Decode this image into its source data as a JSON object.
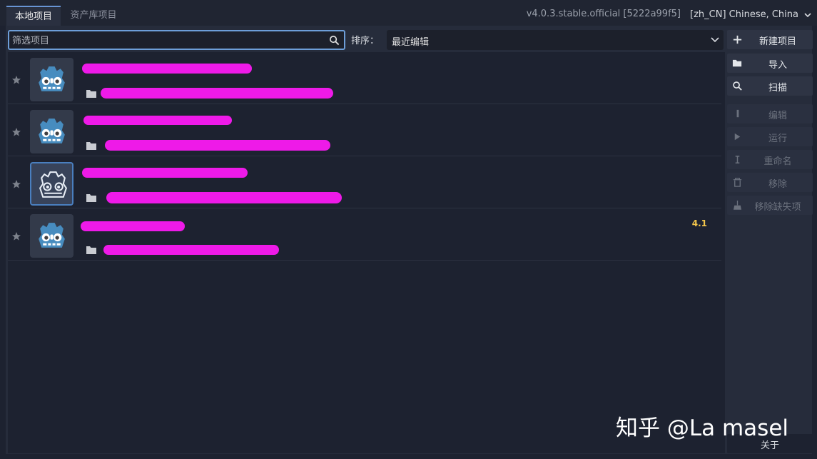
{
  "tabs": [
    {
      "label": "本地项目",
      "active": true
    },
    {
      "label": "资产库项目",
      "active": false
    }
  ],
  "version": "v4.0.3.stable.official [5222a99f5]",
  "language": "[zh_CN] Chinese, China",
  "filter": {
    "placeholder": "筛选项目",
    "value": ""
  },
  "sort": {
    "label": "排序：",
    "selected": "最近编辑"
  },
  "projects": [
    {
      "favorite": false,
      "version_badge": ""
    },
    {
      "favorite": false,
      "version_badge": ""
    },
    {
      "favorite": false,
      "version_badge": "",
      "selected": true
    },
    {
      "favorite": false,
      "version_badge": "4.1"
    }
  ],
  "actions": {
    "new_project": "新建项目",
    "import": "导入",
    "scan": "扫描",
    "edit": "编辑",
    "run": "运行",
    "rename": "重命名",
    "remove": "移除",
    "remove_missing": "移除缺失项",
    "about": "关于"
  },
  "watermark": "知乎 @La masel",
  "colors": {
    "accent": "#6d9ed8",
    "badge": "#f2c54b",
    "redaction": "#ee1ae8"
  }
}
